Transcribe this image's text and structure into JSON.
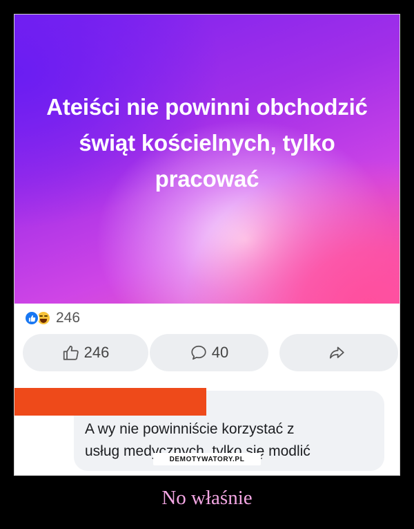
{
  "post": {
    "text_lines": [
      "Ateiści nie powinni obchodzić",
      "świąt kościelnych, tylko",
      "pracować"
    ]
  },
  "reactions": {
    "count": "246",
    "icons": [
      "like-icon",
      "haha-icon"
    ]
  },
  "actions": {
    "like_count": "246",
    "comment_count": "40",
    "icons": [
      "thumbs-up-icon",
      "comment-icon",
      "share-icon"
    ]
  },
  "comment": {
    "lines": [
      "A wy nie powinniście korzystać z",
      "usług medycznych, tylko się modlić"
    ],
    "author_redacted_color": "#ee4a1a"
  },
  "watermark": "DEMOTYWATORY.PL",
  "caption": "No właśnie",
  "colors": {
    "caption": "#f4a7e4",
    "like_blue": "#1877f2"
  }
}
